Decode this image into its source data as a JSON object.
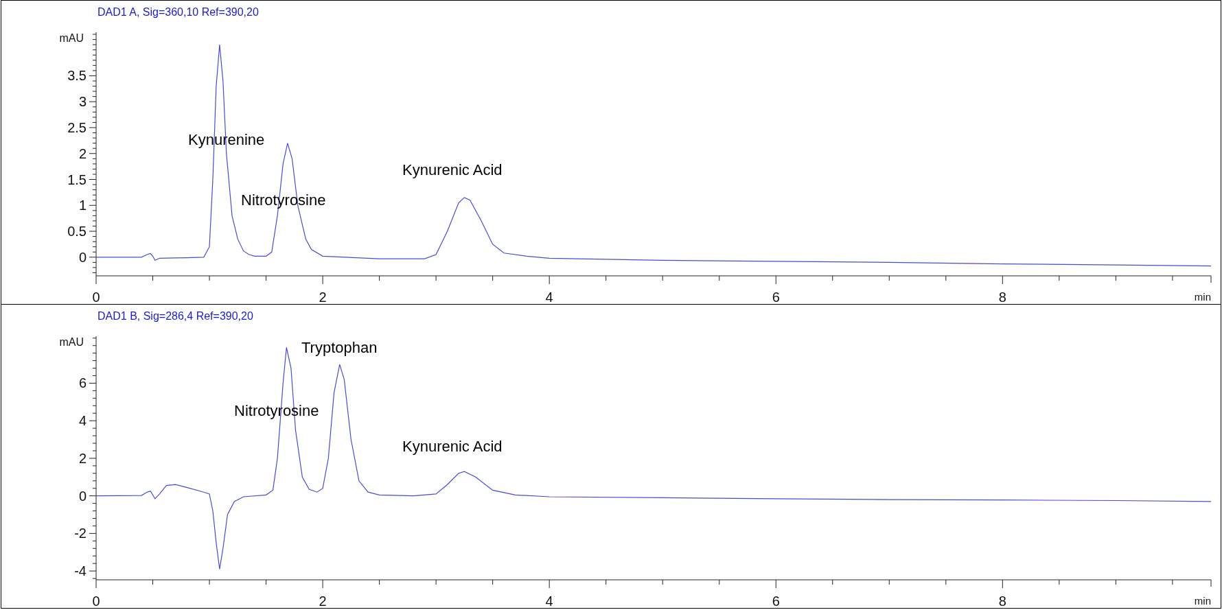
{
  "panels": [
    {
      "chart_data": {
        "type": "line",
        "title": "DAD1 A, Sig=360,10 Ref=390,20",
        "xlabel": "min",
        "ylabel": "mAU",
        "xlim": [
          0,
          9.84
        ],
        "ylim": [
          -0.36,
          4.34
        ],
        "xticks": [
          0,
          2,
          4,
          6,
          8
        ],
        "yticks": [
          0,
          0.5,
          1,
          1.5,
          2,
          2.5,
          3,
          3.5
        ],
        "x": [
          0,
          0.4,
          0.45,
          0.48,
          0.5,
          0.52,
          0.56,
          0.8,
          0.95,
          1.0,
          1.03,
          1.06,
          1.09,
          1.12,
          1.15,
          1.2,
          1.25,
          1.3,
          1.35,
          1.4,
          1.5,
          1.55,
          1.6,
          1.65,
          1.69,
          1.73,
          1.78,
          1.85,
          1.9,
          2.0,
          2.2,
          2.5,
          2.9,
          3.0,
          3.1,
          3.2,
          3.25,
          3.3,
          3.4,
          3.5,
          3.6,
          3.8,
          4.0,
          5,
          6,
          7,
          8,
          9,
          9.84
        ],
        "series": [
          {
            "color": "#4a4ad8",
            "values": [
              0,
              0,
              0.05,
              0.07,
              0.02,
              -0.06,
              -0.02,
              -0.01,
              0,
              0.2,
              1.5,
              3.3,
              4.1,
              3.4,
              2.0,
              0.8,
              0.35,
              0.12,
              0.05,
              0.02,
              0.02,
              0.1,
              0.8,
              1.8,
              2.2,
              1.9,
              1.0,
              0.35,
              0.15,
              0.02,
              0,
              -0.03,
              -0.03,
              0.05,
              0.5,
              1.05,
              1.15,
              1.1,
              0.7,
              0.25,
              0.08,
              0.02,
              -0.02,
              -0.06,
              -0.08,
              -0.1,
              -0.13,
              -0.15,
              -0.17
            ]
          }
        ],
        "annotations": [
          "Kynurenine",
          "Nitrotyrosine",
          "Kynurenic Acid"
        ]
      }
    },
    {
      "chart_data": {
        "type": "line",
        "title": "DAD1 B, Sig=286,4 Ref=390,20",
        "xlabel": "min",
        "ylabel": "mAU",
        "xlim": [
          0,
          9.84
        ],
        "ylim": [
          -4.47,
          8.5
        ],
        "xticks": [
          0,
          2,
          4,
          6,
          8
        ],
        "yticks": [
          -4,
          -2,
          0,
          2,
          4,
          6
        ],
        "x": [
          0,
          0.4,
          0.45,
          0.48,
          0.5,
          0.52,
          0.56,
          0.62,
          0.7,
          0.8,
          0.95,
          1.0,
          1.03,
          1.06,
          1.09,
          1.12,
          1.16,
          1.22,
          1.3,
          1.5,
          1.56,
          1.6,
          1.65,
          1.68,
          1.72,
          1.76,
          1.82,
          1.88,
          1.95,
          2.0,
          2.05,
          2.1,
          2.15,
          2.19,
          2.25,
          2.32,
          2.4,
          2.5,
          2.8,
          3.0,
          3.1,
          3.2,
          3.25,
          3.35,
          3.5,
          3.7,
          4.0,
          5,
          6,
          7,
          8,
          9,
          9.84
        ],
        "series": [
          {
            "color": "#4a4ad8",
            "values": [
              0,
              0.02,
              0.2,
              0.25,
              0.05,
              -0.15,
              0.1,
              0.55,
              0.6,
              0.45,
              0.2,
              0.1,
              -0.8,
              -2.5,
              -3.9,
              -2.8,
              -1.0,
              -0.3,
              -0.05,
              0.05,
              0.3,
              2.0,
              6.0,
              7.9,
              6.8,
              3.5,
              1.0,
              0.35,
              0.2,
              0.4,
              2.0,
              5.5,
              7.0,
              6.2,
              3.0,
              0.8,
              0.2,
              0.05,
              0,
              0.1,
              0.6,
              1.2,
              1.3,
              1.0,
              0.3,
              0.05,
              -0.05,
              -0.1,
              -0.15,
              -0.2,
              -0.22,
              -0.25,
              -0.3
            ]
          }
        ],
        "annotations": [
          "Tryptophan",
          "Nitrotyrosine",
          "Kynurenic Acid"
        ]
      }
    }
  ]
}
